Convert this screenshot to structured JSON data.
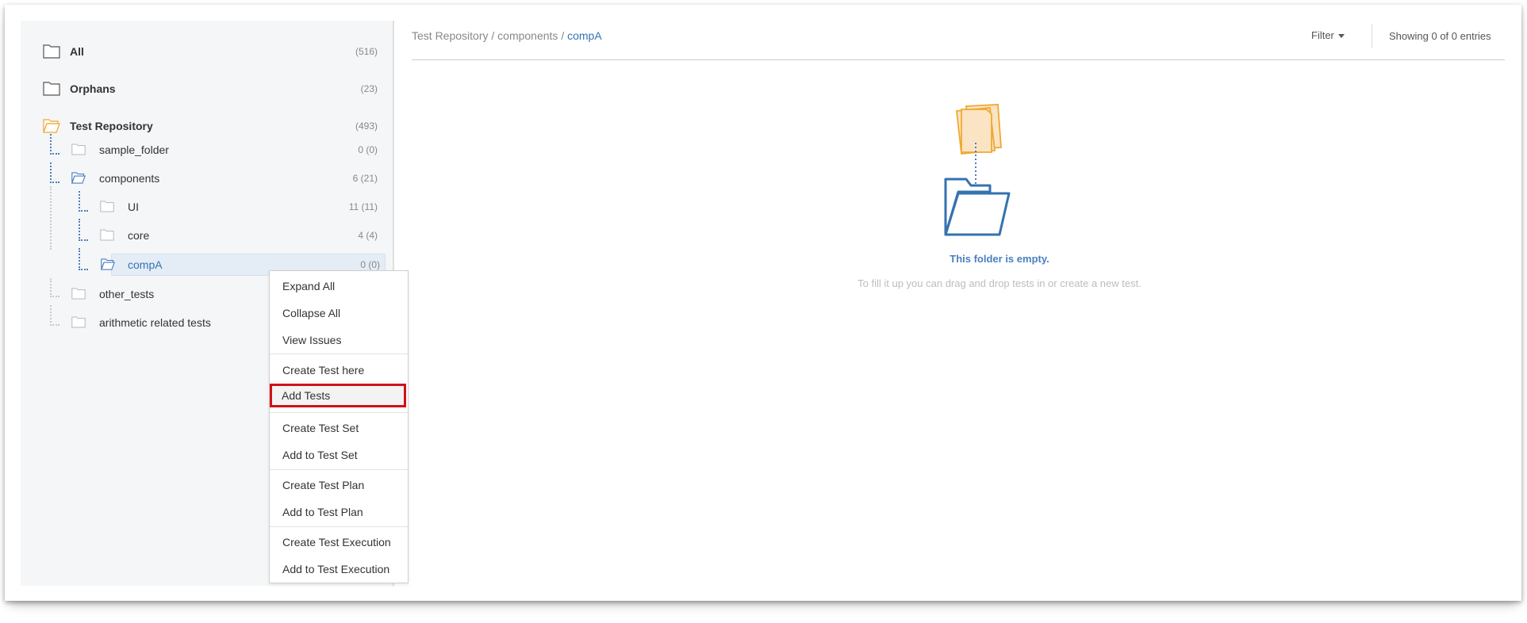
{
  "tree": {
    "top": [
      {
        "label": "All",
        "count": "(516)",
        "icon": "folder-icon"
      },
      {
        "label": "Orphans",
        "count": "(23)",
        "icon": "folder-icon"
      },
      {
        "label": "Test Repository",
        "count": "(493)",
        "icon": "folder-open-icon"
      }
    ],
    "children": [
      {
        "label": "sample_folder",
        "count": "0 (0)"
      },
      {
        "label": "components",
        "count": "6 (21)"
      },
      {
        "label": "UI",
        "count": "11 (11)"
      },
      {
        "label": "core",
        "count": "4 (4)"
      },
      {
        "label": "compA",
        "count": "0 (0)"
      },
      {
        "label": "other_tests",
        "count": ""
      },
      {
        "label": "arithmetic related tests",
        "count": ""
      }
    ]
  },
  "breadcrumb": {
    "part1": "Test Repository",
    "sep1": " / ",
    "part2": "components",
    "sep2": " / ",
    "current": "compA"
  },
  "toolbar": {
    "filter_label": "Filter",
    "showing": "Showing 0 of 0 entries"
  },
  "empty": {
    "title": "This folder is empty.",
    "subtitle": "To fill it up you can drag and drop tests in or create a new test."
  },
  "context_menu": {
    "items": [
      "Expand All",
      "Collapse All",
      "View Issues",
      "Create Test here",
      "Add Tests",
      "Create Test Set",
      "Add to Test Set",
      "Create Test Plan",
      "Add to Test Plan",
      "Create Test Execution",
      "Add to Test Execution"
    ],
    "highlighted": "Add Tests"
  },
  "colors": {
    "accent": "#3572b0",
    "highlight_border": "#d0111b",
    "folder_open": "#f0a830"
  }
}
